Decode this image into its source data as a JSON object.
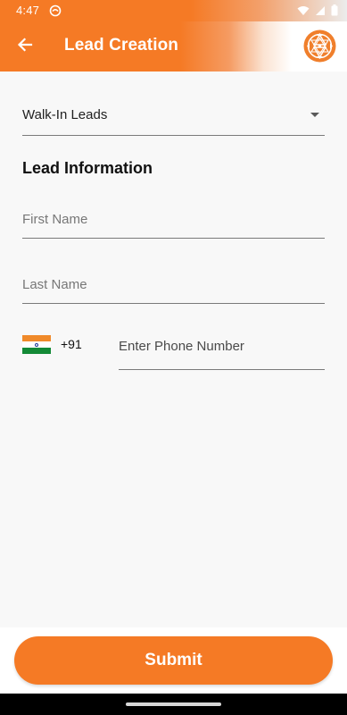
{
  "status_bar": {
    "time": "4:47"
  },
  "app_bar": {
    "title": "Lead Creation"
  },
  "form": {
    "lead_type": "Walk-In Leads",
    "section_title": "Lead Information",
    "first_name_placeholder": "First Name",
    "last_name_placeholder": "Last Name",
    "dial_code": "+91",
    "phone_placeholder": "Enter Phone Number"
  },
  "actions": {
    "submit_label": "Submit"
  },
  "colors": {
    "accent": "#f57a25",
    "background": "#f8f8f8",
    "divider": "#7a7a7a"
  },
  "icons": {
    "back": "arrow-left-icon",
    "logo": "sri-yantra-logo",
    "dropdown": "caret-down-icon",
    "flag": "india-flag-icon"
  }
}
